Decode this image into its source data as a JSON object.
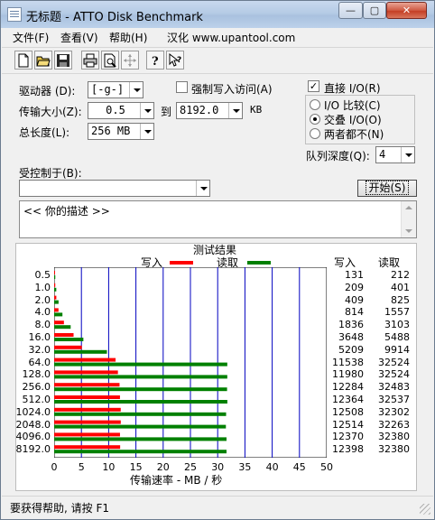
{
  "window": {
    "title": "无标题 - ATTO Disk Benchmark",
    "minimize_glyph": "—",
    "maximize_glyph": "▢",
    "close_glyph": "✕"
  },
  "menu": {
    "file": "文件(F)",
    "view": "查看(V)",
    "help": "帮助(H)",
    "localized": "汉化 www.upantool.com"
  },
  "toolbar": {
    "icons": [
      "new-document-icon",
      "open-folder-icon",
      "save-icon",
      "print-icon",
      "print-preview-icon",
      "move-icon",
      "help-icon",
      "context-help-icon"
    ]
  },
  "settings": {
    "drive_label": "驱动器 (D):",
    "drive_value": "[-g-]",
    "force_write_label": "强制写入访问(A)",
    "force_write_checked": false,
    "transfer_size_label": "传输大小(Z):",
    "transfer_from": "0.5",
    "to_label": "到",
    "transfer_to": "8192.0",
    "kb_label": "KB",
    "total_length_label": "总长度(L):",
    "total_length_value": "256 MB",
    "direct_io_label": "直接 I/O(R)",
    "direct_io_checked": true,
    "io_compare_label": "I/O 比较(C)",
    "overlap_io_label": "交叠 I/O(O)",
    "neither_label": "两者都不(N)",
    "selected_mode": "overlap",
    "queue_depth_label": "队列深度(Q):",
    "queue_depth_value": "4",
    "controlled_by_label": "受控制于(B):",
    "controlled_by_value": "",
    "start_button": "开始(S)",
    "description": "<<  你的描述   >>"
  },
  "results": {
    "title": "测试结果",
    "write_legend": "写入",
    "read_legend": "读取",
    "write_col": "写入",
    "read_col": "读取",
    "xlabel": "传输速率 - MB / 秒"
  },
  "status": {
    "text": "要获得帮助, 请按 F1"
  },
  "chart_data": {
    "type": "bar",
    "orientation": "horizontal",
    "title": "测试结果",
    "xlabel": "传输速率 - MB / 秒",
    "xlim": [
      0,
      50
    ],
    "xticks": [
      "0",
      "5",
      "10",
      "15",
      "20",
      "25",
      "30",
      "35",
      "40",
      "45",
      "50"
    ],
    "categories": [
      "0.5",
      "1.0",
      "2.0",
      "4.0",
      "8.0",
      "16.0",
      "32.0",
      "64.0",
      "128.0",
      "256.0",
      "512.0",
      "1024.0",
      "2048.0",
      "4096.0",
      "8192.0"
    ],
    "series": [
      {
        "name": "写入",
        "color": "#ff0000",
        "values_kbps": [
          131,
          209,
          409,
          814,
          1836,
          3648,
          5209,
          11538,
          11980,
          12284,
          12364,
          12508,
          12514,
          12370,
          12398
        ]
      },
      {
        "name": "读取",
        "color": "#008000",
        "values_kbps": [
          212,
          401,
          825,
          1557,
          3103,
          5488,
          9914,
          32524,
          32524,
          32483,
          32537,
          32302,
          32263,
          32380,
          32380
        ]
      }
    ],
    "grid": true,
    "legend_position": "top"
  }
}
